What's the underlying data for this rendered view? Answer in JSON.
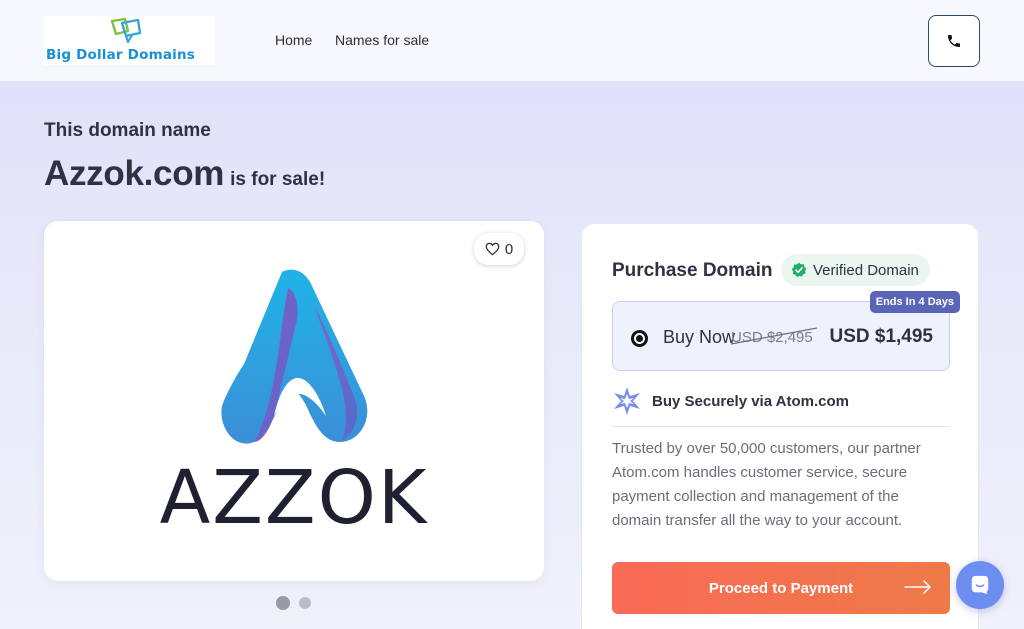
{
  "header": {
    "logo_text": "Big Dollar Domains",
    "nav": [
      "Home",
      "Names for sale"
    ],
    "phone_icon": "phone-icon"
  },
  "hero": {
    "pre_title": "This domain name",
    "domain": "Azzok.com",
    "suffix": "is for sale!"
  },
  "gallery": {
    "likes": "0",
    "brand_word": "AZZOK",
    "slides": 2,
    "active_slide": 1
  },
  "purchase": {
    "title": "Purchase Domain",
    "verified_label": "Verified Domain",
    "ends_badge": "Ends In 4 Days",
    "option_label": "Buy Now",
    "old_price": "USD $2,495",
    "new_price": "USD $1,495",
    "secure_label": "Buy Securely via Atom.com",
    "trust_text": "Trusted by over 50,000 customers, our partner Atom.com handles customer service, secure payment collection and management of the domain transfer all the way to your account.",
    "cta_label": "Proceed to Payment"
  },
  "colors": {
    "accent": "#f96a57",
    "verified": "#1fae6a",
    "badge": "#5b65b8",
    "chat": "#6b8ef0"
  }
}
